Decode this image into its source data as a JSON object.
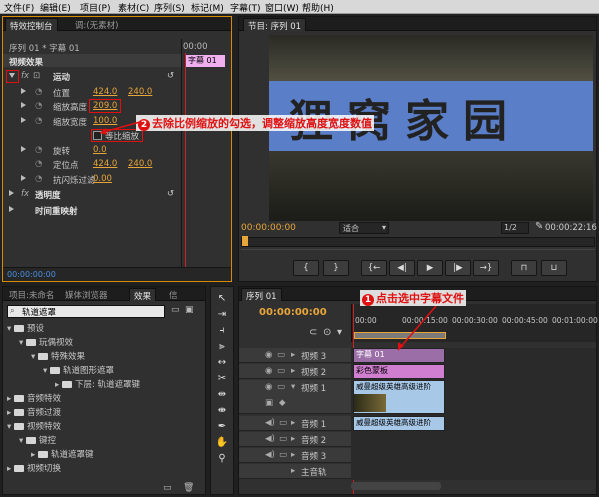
{
  "menu": [
    "文件(F)",
    "编辑(E)",
    "项目(P)",
    "素材(C)",
    "序列(S)",
    "标记(M)",
    "字幕(T)",
    "窗口(W)",
    "帮助(H)"
  ],
  "effect_controls": {
    "tabs": [
      "特效控制台",
      "调:(无素材)"
    ],
    "sequence_label": "序列 01 * 字幕 01",
    "timeline_start": "00:00",
    "clip_badge": "字幕 01",
    "video_effects": "视频效果",
    "motion": "运动",
    "position_label": "位置",
    "position_x": "424.0",
    "position_y": "240.0",
    "scale_h_label": "缩放高度",
    "scale_h": "209.0",
    "scale_w_label": "缩放宽度",
    "scale_w": "100.0",
    "uniform_scale": "等比缩放",
    "rotation_label": "旋转",
    "rotation": "0.0",
    "anchor_label": "定位点",
    "anchor_x": "424.0",
    "anchor_y": "240.0",
    "antiflicker_label": "抗闪烁过滤",
    "antiflicker": "0.00",
    "opacity": "透明度",
    "time_remap": "时间重映射",
    "timecode": "00:00:00:00"
  },
  "program": {
    "tab": "节目: 序列 01",
    "video_text": "狸窝家园",
    "timecode_left": "00:00:00:00",
    "fit": "适合",
    "ratio": "1/2",
    "timecode_right": "00:00:22:16"
  },
  "project": {
    "tabs": [
      "项目:未命名",
      "媒体浏览器",
      "效果",
      "信"
    ],
    "search": "轨道遮罩",
    "tree": [
      {
        "label": "预设",
        "depth": 0
      },
      {
        "label": "玩偶视效",
        "depth": 1
      },
      {
        "label": "特殊效果",
        "depth": 2
      },
      {
        "label": "轨道图形遮罩",
        "depth": 3
      },
      {
        "label": "下层: 轨道遮罩键",
        "depth": 4
      },
      {
        "label": "音频特效",
        "depth": 0
      },
      {
        "label": "音频过渡",
        "depth": 0
      },
      {
        "label": "视频特效",
        "depth": 0
      },
      {
        "label": "键控",
        "depth": 1
      },
      {
        "label": "轨道遮罩键",
        "depth": 2
      },
      {
        "label": "视频切换",
        "depth": 0
      }
    ]
  },
  "timeline": {
    "tab": "序列 01",
    "timecode": "00:00:00:00",
    "ruler": [
      "00:00",
      "00:00:15:00",
      "00:00:30:00",
      "00:00:45:00",
      "00:01:00:00"
    ],
    "tracks": [
      "视频 3",
      "视频 2",
      "视频 1",
      "音频 1",
      "音频 2",
      "音频 3",
      "主音轨"
    ],
    "clips": {
      "v3": "字幕 01",
      "v2": "彩色蒙板",
      "v1": "威曼超级英雄高级进阶",
      "a1": "威曼超级英雄高级进阶"
    }
  },
  "annotations": {
    "step1_num": "1",
    "step1": "点击选中字幕文件",
    "step2_num": "2",
    "step2": "去除比例缩放的勾选，调整缩放高度宽度数值"
  },
  "colors": {
    "accent": "#e8a63a",
    "callout": "#e01010",
    "clip_v3": "#9b6ea8",
    "clip_v2": "#d07fd0",
    "clip_v1": "#a8c8e8"
  }
}
